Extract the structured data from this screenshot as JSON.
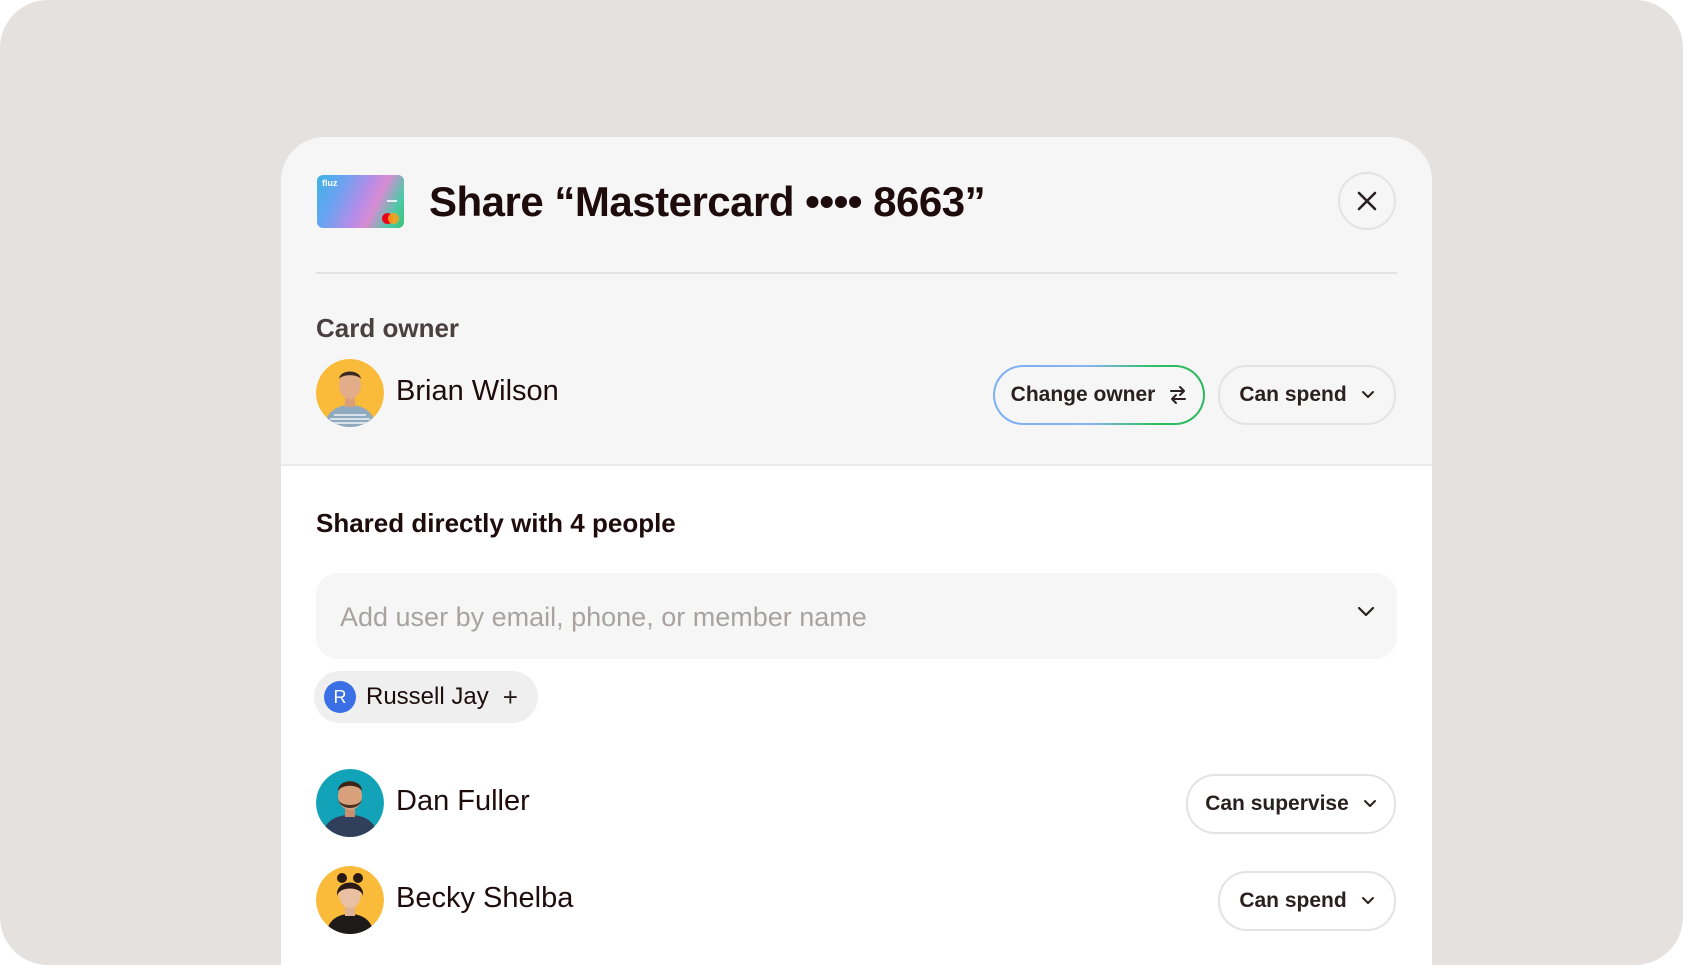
{
  "modal": {
    "card_brand": "fluz",
    "title": "Share “Mastercard •••• 8663”",
    "close_label": "×"
  },
  "owner_section": {
    "label": "Card owner",
    "owner_name": "Brian Wilson",
    "change_owner_label": "Change owner",
    "permission": "Can spend"
  },
  "shared_section": {
    "heading": "Shared directly with 4 people",
    "add_user_placeholder": "Add user by email, phone, or member name",
    "suggestion": {
      "initial": "R",
      "name": "Russell Jay",
      "add_label": "+"
    },
    "people": [
      {
        "name": "Dan Fuller",
        "permission": "Can supervise"
      },
      {
        "name": "Becky Shelba",
        "permission": "Can spend"
      }
    ]
  },
  "colors": {
    "backdrop": "#e5e1df",
    "accent_blue": "#3b6fe6",
    "accent_green": "#2fbf65",
    "avatar_yellow": "#fbbb3a",
    "avatar_teal": "#12a3b8"
  }
}
